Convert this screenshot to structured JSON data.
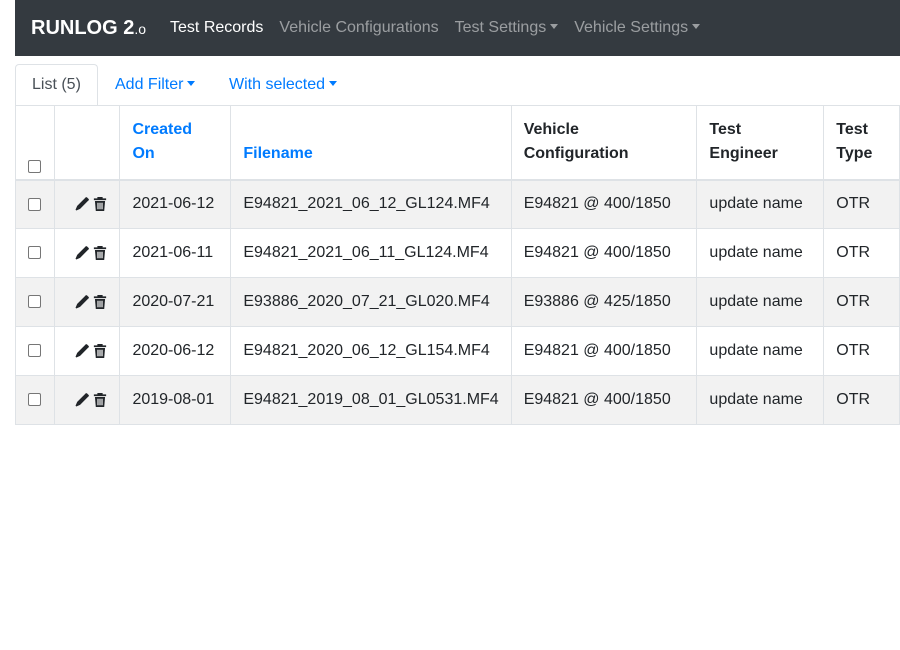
{
  "navbar": {
    "brand_main": "RUNLOG 2",
    "brand_suffix": ".o",
    "items": [
      {
        "label": "Test Records",
        "active": true,
        "dropdown": false
      },
      {
        "label": "Vehicle Configurations",
        "active": false,
        "dropdown": false
      },
      {
        "label": "Test Settings",
        "active": false,
        "dropdown": true
      },
      {
        "label": "Vehicle Settings",
        "active": false,
        "dropdown": true
      }
    ]
  },
  "tabs": {
    "list": "List (5)",
    "add_filter": "Add Filter",
    "with_selected": "With selected"
  },
  "table": {
    "headers": {
      "created_on": "Created On",
      "filename": "Filename",
      "vehicle_configuration": "Vehicle Configuration",
      "test_engineer": "Test Engineer",
      "test_type": "Test Type"
    },
    "rows": [
      {
        "created_on": "2021-06-12",
        "filename": "E94821_2021_06_12_GL124.MF4",
        "vehicle_configuration": "E94821 @ 400/1850",
        "test_engineer": "update name",
        "test_type": "OTR"
      },
      {
        "created_on": "2021-06-11",
        "filename": "E94821_2021_06_11_GL124.MF4",
        "vehicle_configuration": "E94821 @ 400/1850",
        "test_engineer": "update name",
        "test_type": "OTR"
      },
      {
        "created_on": "2020-07-21",
        "filename": "E93886_2020_07_21_GL020.MF4",
        "vehicle_configuration": "E93886 @ 425/1850",
        "test_engineer": "update name",
        "test_type": "OTR"
      },
      {
        "created_on": "2020-06-12",
        "filename": "E94821_2020_06_12_GL154.MF4",
        "vehicle_configuration": "E94821 @ 400/1850",
        "test_engineer": "update name",
        "test_type": "OTR"
      },
      {
        "created_on": "2019-08-01",
        "filename": "E94821_2019_08_01_GL0531.MF4",
        "vehicle_configuration": "E94821 @ 400/1850",
        "test_engineer": "update name",
        "test_type": "OTR"
      }
    ]
  },
  "icons": {
    "edit": "pencil-icon",
    "delete": "trash-icon"
  },
  "colors": {
    "navbar_bg": "#343a40",
    "link": "#007bff",
    "row_stripe": "#f2f2f2"
  }
}
